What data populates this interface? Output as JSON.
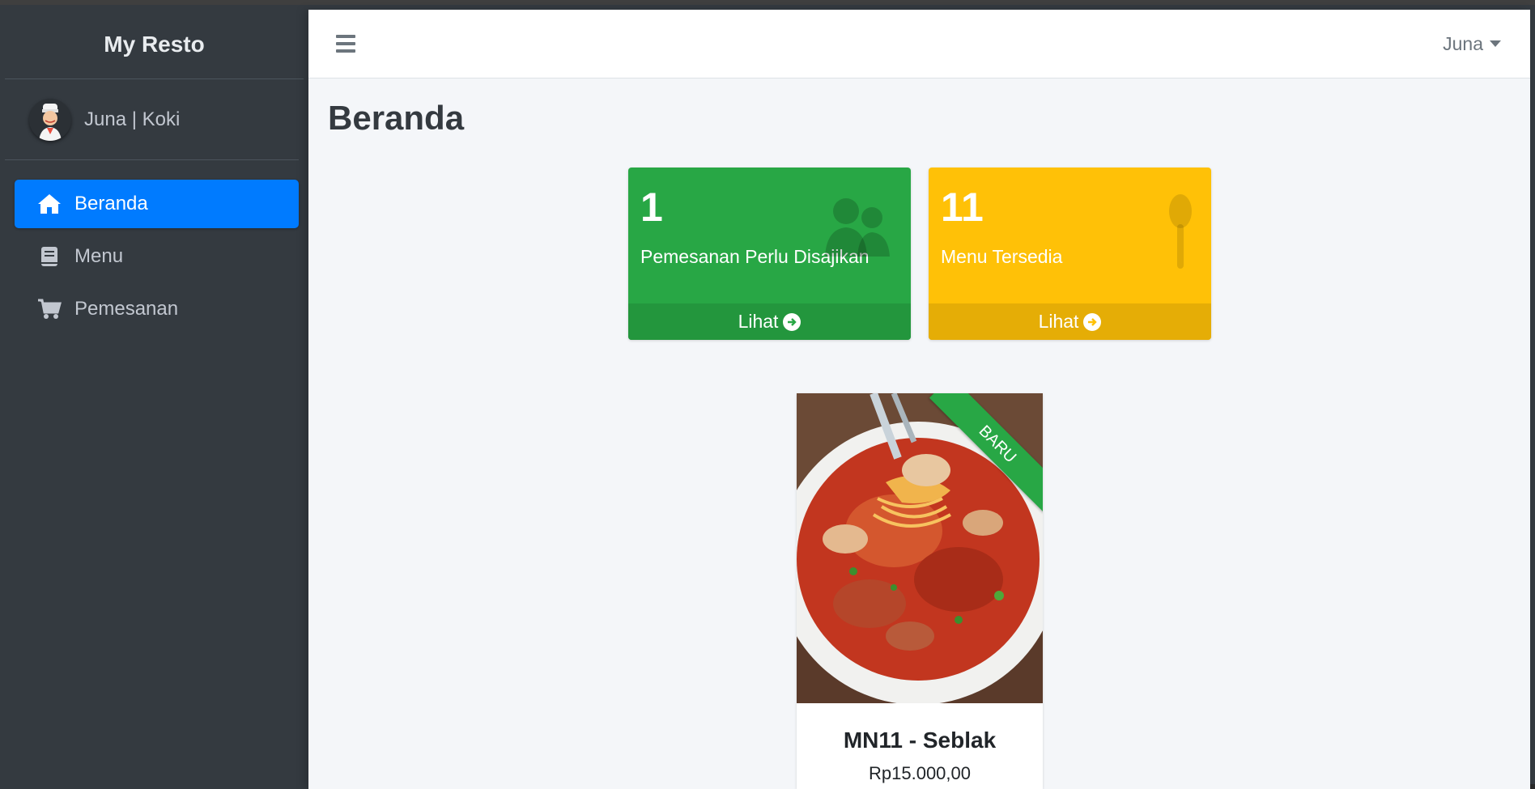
{
  "app": {
    "brand": "My Resto"
  },
  "user_panel": {
    "name": "Juna | Koki"
  },
  "sidebar": {
    "items": [
      {
        "label": "Beranda",
        "icon": "home-icon",
        "active": true
      },
      {
        "label": "Menu",
        "icon": "book-icon",
        "active": false
      },
      {
        "label": "Pemesanan",
        "icon": "cart-icon",
        "active": false
      }
    ]
  },
  "topbar": {
    "user_menu": "Juna"
  },
  "page": {
    "title": "Beranda"
  },
  "stats": [
    {
      "value": "1",
      "label": "Pemesanan Perlu Disajikan",
      "link": "Lihat",
      "color": "#28a745",
      "icon": "users-icon"
    },
    {
      "value": "11",
      "label": "Menu Tersedia",
      "link": "Lihat",
      "color": "#ffc107",
      "icon": "spoon-icon"
    }
  ],
  "menu_card": {
    "ribbon": "BARU",
    "title": "MN11 - Seblak",
    "price": "Rp15.000,00",
    "image": "seblak-food-photo"
  },
  "colors": {
    "accent": "#007bff",
    "sidebar_bg": "#343a40",
    "content_bg": "#f4f6f9"
  }
}
